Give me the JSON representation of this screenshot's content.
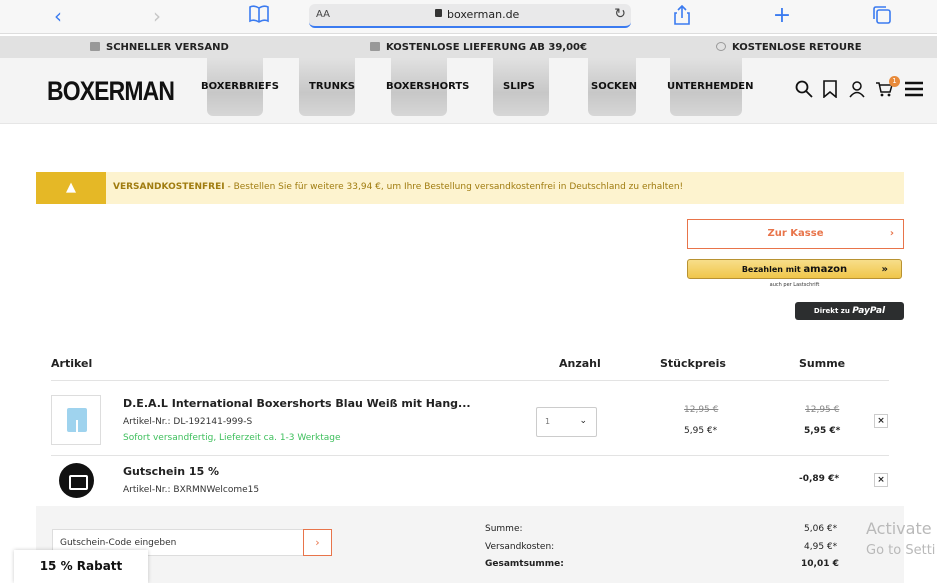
{
  "browser": {
    "aa_label": "AA",
    "url": "boxerman.de",
    "icons": [
      "back-icon",
      "forward-icon",
      "bookmarks-icon",
      "share-icon",
      "new-tab-icon",
      "tabs-icon",
      "lock-icon",
      "reload-icon"
    ]
  },
  "infobar": {
    "shipping": "SCHNELLER VERSAND",
    "free_delivery": "KOSTENLOSE LIEFERUNG AB 39,00€",
    "returns": "KOSTENLOSE RETOURE"
  },
  "nav": {
    "logo": "BOXERMAN",
    "links": [
      "BOXERBRIEFS",
      "TRUNKS",
      "BOXERSHORTS",
      "SLIPS",
      "SOCKEN",
      "UNTERHEMDEN"
    ],
    "cart_count": "1",
    "icons": [
      "search-icon",
      "bookmark-icon",
      "user-icon",
      "cart-icon",
      "menu-icon"
    ]
  },
  "alert": {
    "icon": "warning-icon",
    "title": "VERSANDKOSTENFREI",
    "message": " - Bestellen Sie für weitere 33,94 €, um Ihre Bestellung versandkostenfrei in Deutschland zu erhalten!"
  },
  "checkout": {
    "kasse_label": "Zur Kasse",
    "arrow": "›",
    "amazon_prefix": "Bezahlen mit",
    "amazon_brand": "amazon",
    "amazon_sub": "auch per Lastschrift",
    "paypal_prefix": "Direkt zu",
    "paypal_brand": "PayPal"
  },
  "table": {
    "headers": {
      "article": "Artikel",
      "qty": "Anzahl",
      "unit": "Stückpreis",
      "sum": "Summe"
    },
    "item": {
      "name": "D.E.A.L International Boxershorts Blau Weiß mit Hang...",
      "sku": "Artikel-Nr.: DL-192141-999-S",
      "availability": "Sofort versandfertig, Lieferzeit ca. 1-3 Werktage",
      "qty": "1",
      "unit_old": "12,95 €",
      "unit_new": "5,95 €*",
      "sum_old": "12,95 €",
      "sum_new": "5,95 €*",
      "remove": "×"
    },
    "voucher": {
      "name": "Gutschein 15 %",
      "sku": "Artikel-Nr.: BXRMNWelcome15",
      "sum": "-0,89 €*",
      "remove": "×"
    }
  },
  "summary": {
    "coupon_placeholder": "Gutschein-Code eingeben",
    "coupon_btn": "›",
    "rows": [
      {
        "label": "Summe:",
        "value": "5,06 €*"
      },
      {
        "label": "Versandkosten:",
        "value": "4,95 €*"
      },
      {
        "label": "Gesamtsumme:",
        "value": "10,01 €"
      }
    ]
  },
  "rabatt_label": "15 % Rabatt",
  "windows": {
    "activate": "Activate",
    "goto": "Go to Setti"
  },
  "colors": {
    "accent": "#e8744a",
    "warning": "#e5b826",
    "alert_bg": "#fdf3cf",
    "ok": "#3ebf5c"
  }
}
